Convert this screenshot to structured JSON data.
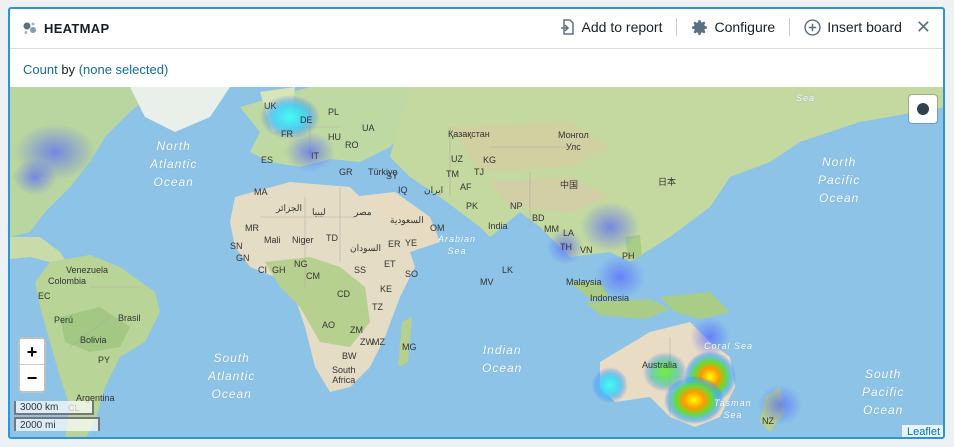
{
  "header": {
    "title": "HEATMAP",
    "add_to_report": "Add to report",
    "configure": "Configure",
    "insert_board": "Insert board",
    "close": "✕"
  },
  "subbar": {
    "metric": "Count",
    "by": "by",
    "grouping": "(none selected)"
  },
  "map": {
    "oceans": {
      "north_atlantic": "North\nAtlantic\nOcean",
      "south_atlantic": "South\nAtlantic\nOcean",
      "indian": "Indian\nOcean",
      "north_pacific": "North\nPacific\nOcean",
      "south_pacific": "South\nPacific\nOcean",
      "arabian_sea": "Arabian\nSea",
      "coral_sea": "Coral Sea",
      "tasman_sea": "Tasman\nSea",
      "sea": "Sea"
    },
    "labels": {
      "uk": "UK",
      "fr": "FR",
      "de": "DE",
      "pl": "PL",
      "ua": "UA",
      "hu": "HU",
      "ro": "RO",
      "it": "IT",
      "es": "ES",
      "gr": "GR",
      "turkey": "Türkiye",
      "kazakhstan": "Қазақстан",
      "mongolia": "Монгол\nУлс",
      "uz": "UZ",
      "kg": "KG",
      "tm": "TM",
      "tj": "TJ",
      "af": "AF",
      "iran": "ایران",
      "iq": "IQ",
      "sy": "SY",
      "pk": "PK",
      "np": "NP",
      "bd": "BD",
      "india": "India",
      "mm": "MM",
      "la": "LA",
      "th": "TH",
      "vn": "VN",
      "ph": "PH",
      "china": "中国",
      "japan": "日本",
      "malaysia": "Malaysia",
      "indonesia": "Indonesia",
      "lk": "LK",
      "mv": "MV",
      "ma": "MA",
      "dz": "الجزائر",
      "ly": "ليبيا",
      "eg": "مصر",
      "sa": "السعودية",
      "om": "OM",
      "ye": "YE",
      "mr": "MR",
      "ml": "Mali",
      "ne": "Niger",
      "td": "TD",
      "sd": "السودان",
      "er": "ER",
      "sn": "SN",
      "gn": "GN",
      "ci": "CI",
      "gh": "GH",
      "ng": "NG",
      "cm": "CM",
      "ss": "SS",
      "et": "ET",
      "so": "SO",
      "ke": "KE",
      "cd": "CD",
      "ao": "AO",
      "tz": "TZ",
      "mz": "MZ",
      "mg": "MG",
      "zm": "ZM",
      "zw": "ZW",
      "bw": "BW",
      "za": "South\nAfrica",
      "venezuela": "Venezuela",
      "colombia": "Colombia",
      "ec": "EC",
      "peru": "Perú",
      "brasil": "Brasil",
      "bolivia": "Bolivia",
      "py": "PY",
      "argentina": "Argentina",
      "cl": "CL",
      "australia": "Australia",
      "nz": "NZ"
    },
    "zoom_in": "+",
    "zoom_out": "−",
    "scale_km": "3000 km",
    "scale_mi": "2000 mi",
    "attribution": "Leaflet"
  }
}
